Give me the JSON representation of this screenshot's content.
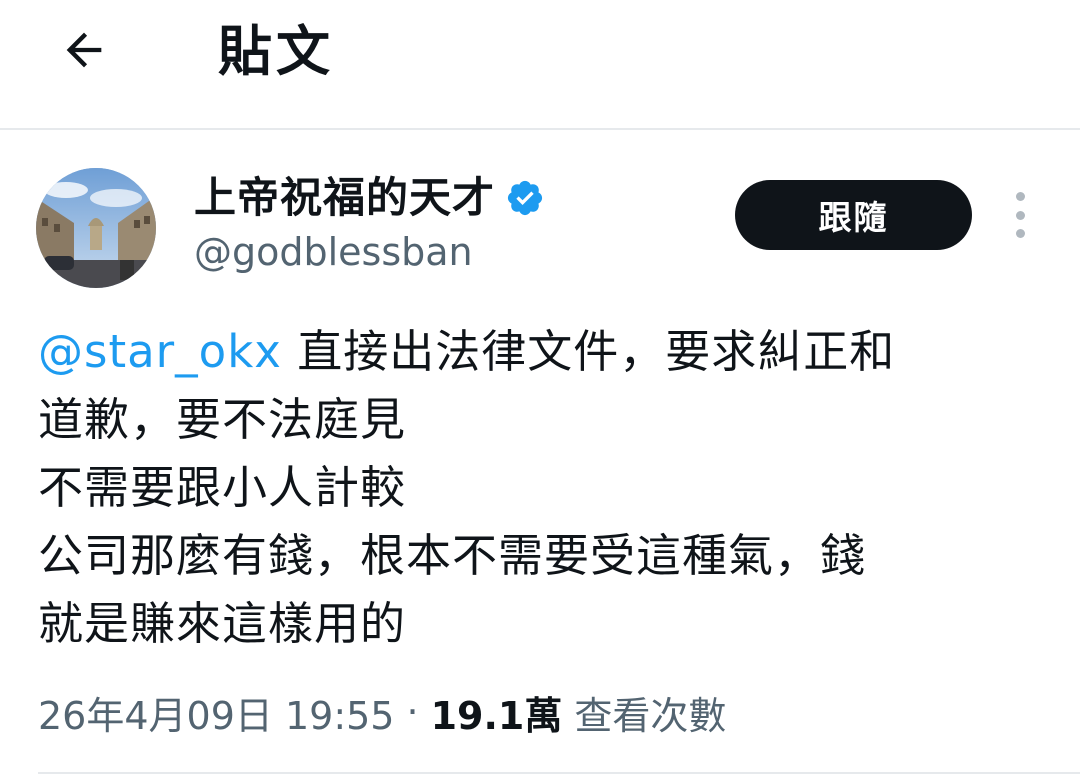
{
  "header": {
    "title": "貼文",
    "back_icon": "arrow-left-icon"
  },
  "author": {
    "display_name": "上帝祝福的天才",
    "handle": "@godblessban",
    "verified": true,
    "verified_color": "#1d9bf0",
    "avatar": "street-photo-avatar"
  },
  "actions": {
    "follow_label": "跟隨",
    "more_icon": "more-vertical-icon"
  },
  "tweet": {
    "mention": "@star_okx",
    "line1_rest": " 直接出法律文件，要求糾正和",
    "line2": "道歉，要不法庭見",
    "line3": "不需要跟小人計較",
    "line4": "公司那麼有錢，根本不需要受這種氣，錢",
    "line5": "就是賺來這樣用的"
  },
  "meta": {
    "timestamp": "26年4月09日 19:55",
    "separator": "·",
    "views_count": "19.1萬",
    "views_label": "查看次數"
  },
  "colors": {
    "text": "#0f1419",
    "secondary": "#536471",
    "accent": "#1d9bf0",
    "divider": "#e6e9ec"
  }
}
